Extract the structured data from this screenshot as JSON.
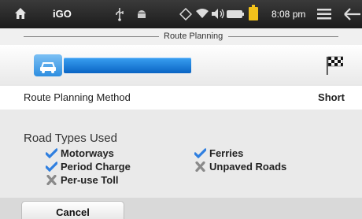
{
  "status_bar": {
    "app_name": "iGO",
    "time": "8:08 pm",
    "icons": [
      "home-icon",
      "usb-icon",
      "android-icon",
      "gps-icon",
      "wifi-icon",
      "volume-icon",
      "battery-icon",
      "notification-icon",
      "menu-icon",
      "back-icon"
    ]
  },
  "header": {
    "title": "Route Planning"
  },
  "route_bar": {
    "start_icon": "car-icon",
    "end_icon": "checkered-flag-icon",
    "accent_color": "#1a7ad6"
  },
  "route_method": {
    "label": "Route Planning Method",
    "value": "Short"
  },
  "road_types": {
    "title": "Road Types Used",
    "items": [
      {
        "label": "Motorways",
        "state": "allowed",
        "icon": "checkmark-icon"
      },
      {
        "label": "Period Charge",
        "state": "allowed",
        "icon": "checkmark-icon"
      },
      {
        "label": "Per-use Toll",
        "state": "avoided",
        "icon": "cross-icon"
      },
      {
        "label": "Ferries",
        "state": "allowed",
        "icon": "checkmark-icon"
      },
      {
        "label": "Unpaved Roads",
        "state": "avoided",
        "icon": "cross-icon"
      }
    ]
  },
  "footer": {
    "cancel_label": "Cancel"
  },
  "colors": {
    "check": "#2f7fe0",
    "cross": "#8a8a8a",
    "status_bar": "#262626"
  }
}
